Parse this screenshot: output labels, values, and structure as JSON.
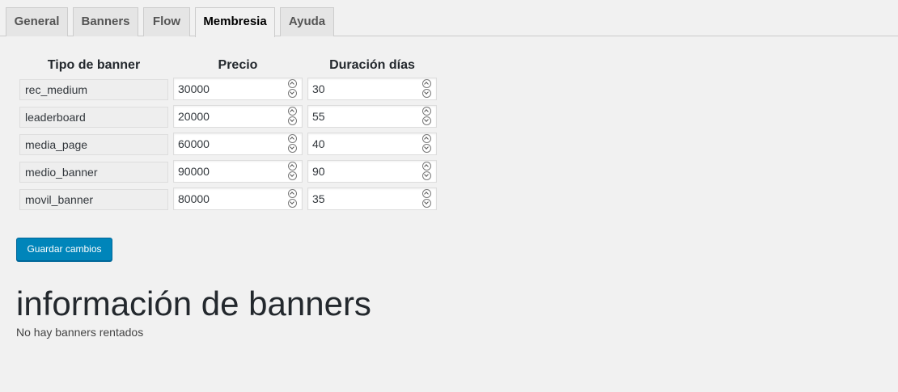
{
  "tabs": [
    {
      "label": "General",
      "active": false
    },
    {
      "label": "Banners",
      "active": false
    },
    {
      "label": "Flow",
      "active": false
    },
    {
      "label": "Membresia",
      "active": true
    },
    {
      "label": "Ayuda",
      "active": false
    }
  ],
  "table": {
    "headers": {
      "type": "Tipo de banner",
      "price": "Precio",
      "duration": "Duración días"
    },
    "rows": [
      {
        "type": "rec_medium",
        "price": "30000",
        "duration": "30"
      },
      {
        "type": "leaderboard",
        "price": "20000",
        "duration": "55"
      },
      {
        "type": "media_page",
        "price": "60000",
        "duration": "40"
      },
      {
        "type": "medio_banner",
        "price": "90000",
        "duration": "90"
      },
      {
        "type": "movil_banner",
        "price": "80000",
        "duration": "35"
      }
    ]
  },
  "save_button": {
    "label": "Guardar cambios",
    "color": "#0085ba"
  },
  "info": {
    "title": "información de banners",
    "message": "No hay banners rentados"
  }
}
